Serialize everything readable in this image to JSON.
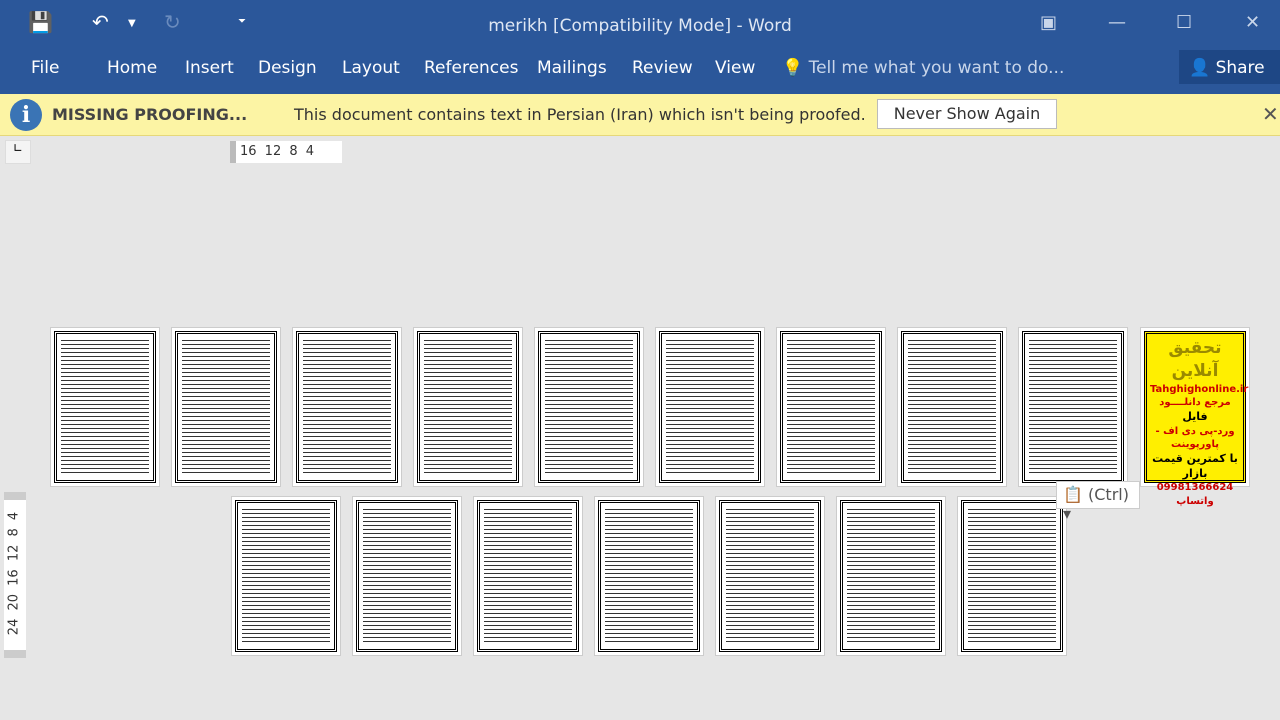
{
  "title": "merikh [Compatibility Mode] - Word",
  "tabs": [
    "File",
    "Home",
    "Insert",
    "Design",
    "Layout",
    "References",
    "Mailings",
    "Review",
    "View"
  ],
  "tell_me": "Tell me what you want to do...",
  "share": "Share",
  "message": {
    "head": "MISSING PROOFING...",
    "text": "This document contains text in Persian (Iran) which isn't being proofed.",
    "button": "Never Show Again"
  },
  "hruler": "16 12 8 4",
  "vruler": "24 20 16 12 8 4",
  "ad": {
    "l1": "تحقیق آنلاین",
    "l2": "Tahghighonline.ir",
    "l3": "مرجع دانلــــود",
    "l4": "فایل",
    "l5": "ورد-پی دی اف - پاورپوینت",
    "l6": "با کمترین قیمت بازار",
    "l7": "09981366624 واتساپ"
  },
  "paste": "(Ctrl)"
}
